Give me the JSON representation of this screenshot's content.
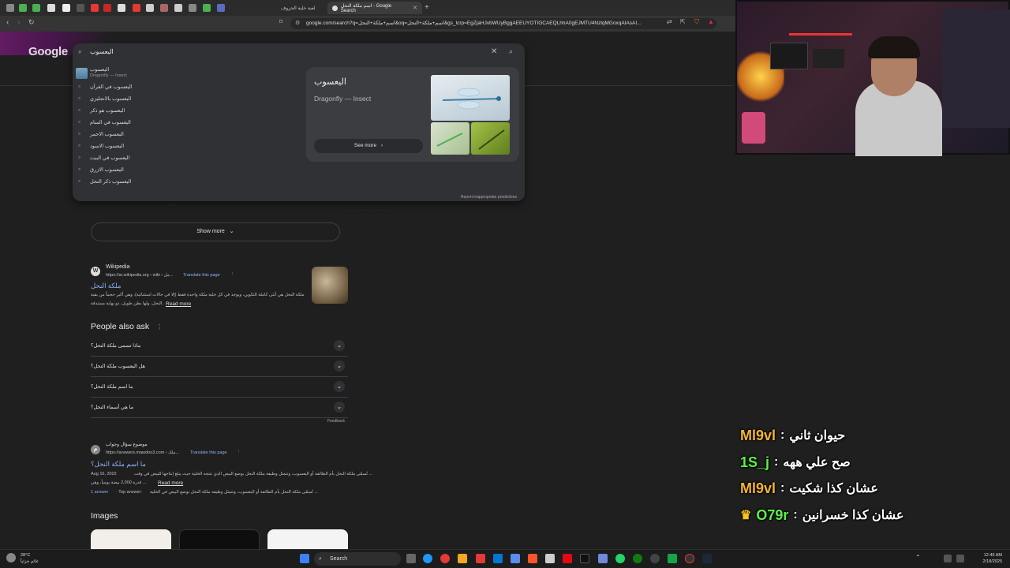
{
  "browser": {
    "tabs": [
      {
        "label": "لعبة خلية الحروف",
        "active": false
      },
      {
        "label": "اسم ملكة النحل - Google Search",
        "active": true
      }
    ],
    "url": "google.com/search?q=اسم+ملكة+النحل&oq=اسم+ملكة+النحل&gs_lcrp=EgZjaHJvbWUyBggAEEUYOTIGCAEQLhhA0gEJMTU4NzlqMGoxqAIAsAI..."
  },
  "google": {
    "logo": "Google",
    "search_value": "اليعسوب",
    "suggestions": [
      {
        "text": "اليعسوب",
        "sub": "Dragonfly — Insect"
      },
      {
        "text": "اليعسوب في القرآن"
      },
      {
        "text": "اليعسوب بالانجليزي"
      },
      {
        "text": "اليعسوب هو ذكر"
      },
      {
        "text": "اليعسوب في المنام"
      },
      {
        "text": "اليعسوب الاحمر"
      },
      {
        "text": "اليعسوب الاسود"
      },
      {
        "text": "اليعسوب في البيت"
      },
      {
        "text": "اليعسوب الازرق"
      },
      {
        "text": "اليعسوب ذكر النحل"
      }
    ],
    "knowledge": {
      "title": "اليعسوب",
      "subtitle": "Dragonfly — Insect",
      "see_more": "See more"
    },
    "report": "Report inappropriate predictions",
    "show_more": "Show more",
    "wiki": {
      "source": "Wikipedia",
      "url": "https://ar.wikipedia.org › wiki › مل...",
      "translate": "Translate this page",
      "title": "ملكة النحل",
      "snippet1": "ملكة النحل هي أنثى كاملة التكوين، ويوجد في كل خلية ملكة واحدة فقط (إلا في حالات استثنائية). وهي أكبر حجماً من بقية",
      "snippet2": "النحل، ولها بطن طويل، ذو نهاية مستدقة.",
      "read_more": "Read more"
    },
    "paa": {
      "title": "People also ask",
      "questions": [
        "ماذا تسمى ملكة النحل؟",
        "هل اليعسوب ملكة النحل؟",
        "ما اسم ملكة النحل؟",
        "ما هي أسماء النحل؟"
      ],
      "feedback": "Feedback"
    },
    "mawdoo": {
      "source": "موضوع سؤال وجواب",
      "url": "https://answers.mawdoo3.com › ملك...",
      "translate": "Translate this page",
      "title": "ما اسم ملكة النحل؟",
      "date": "Aug 16, 2022",
      "snippet1": "تُسمّى ملكة النحل بأم الطائفة أو اليعسوب، وتتمثل وظيفة ملكة النحل بوضع البيض الذي تنتجه الخلية حيث يبلغ إنتاجها للبيض في وقت ...",
      "snippet2": "قدرة 2,000 بيضة يومياً، وهي ...",
      "read_more": "Read more",
      "answer": "1 answer",
      "top_answer": "· Top answer:",
      "answer_text": "تُسمّى ملكة النحل بأم الطائفة أو اليعسوب، وتتمثل وظيفة ملكة النحل بوضع البيض في الخلية ..."
    },
    "images_heading": "Images"
  },
  "chat": [
    {
      "user": "Ml9vl",
      "msg": "حيوان ثاني",
      "color": "#f5b52d"
    },
    {
      "user": "1S_j",
      "msg": "صح علي ههه",
      "color": "#5ef04a"
    },
    {
      "user": "Ml9vl",
      "msg": "عشان كذا شكيت",
      "color": "#f5b52d"
    },
    {
      "user": "O79r",
      "msg": "عشان كذا خسرانين",
      "color": "#5ef04a",
      "badge": "♛"
    }
  ],
  "taskbar": {
    "search": "Search",
    "temp": "28°C",
    "weather": "غائم جزئياً",
    "time": "12:46 AM",
    "date": "2/18/2025"
  }
}
